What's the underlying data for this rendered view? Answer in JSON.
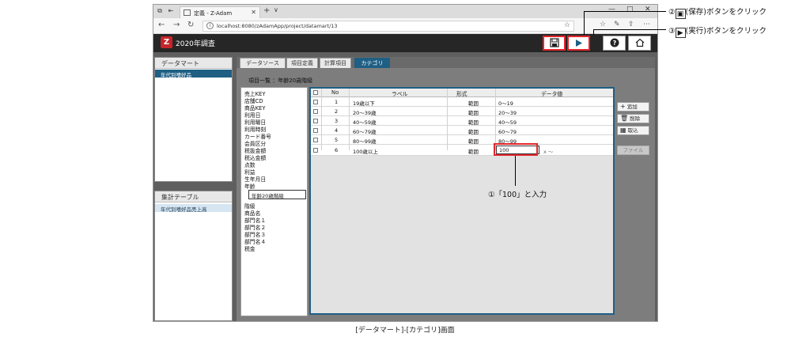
{
  "browser": {
    "tab_title": "定義 - Z-Adam",
    "url": "localhost:8080/zAdamApp/project/datamart/13"
  },
  "app": {
    "logo": "Z",
    "title": "2020年調査"
  },
  "left_panels": {
    "datamart_title": "データマート",
    "datamart_selected": "年代別嗜好品",
    "aggregate_title": "集計テーブル",
    "aggregate_selected": "年代別嗜好品売上高"
  },
  "tabs": [
    "データソース",
    "項目定義",
    "計算項目",
    "カテゴリ"
  ],
  "item_list_label": "項目一覧 ：年齢20歳階級",
  "fields_before": [
    "売上KEY",
    "店舗CD",
    "商品KEY",
    "利用日",
    "利用曜日",
    "利用時刻",
    "カード番号",
    "会員区分",
    "税抜金額",
    "税込金額",
    "点数",
    "利益",
    "生年月日",
    "年齢"
  ],
  "field_selected": "年齢20歳階級",
  "fields_after": [
    "階級",
    "商品名",
    "部門名１",
    "部門名２",
    "部門名３",
    "部門名４",
    "税金"
  ],
  "grid": {
    "headers": [
      "No",
      "ラベル",
      "形式",
      "データ値"
    ],
    "rows": [
      {
        "no": "1",
        "label": "19歳以下",
        "format": "範囲",
        "value": "0～19"
      },
      {
        "no": "2",
        "label": "20～39歳",
        "format": "範囲",
        "value": "20～39"
      },
      {
        "no": "3",
        "label": "40～59歳",
        "format": "範囲",
        "value": "40～59"
      },
      {
        "no": "4",
        "label": "60～79歳",
        "format": "範囲",
        "value": "60～79"
      },
      {
        "no": "5",
        "label": "80～99歳",
        "format": "範囲",
        "value": "80～99"
      },
      {
        "no": "6",
        "label": "100歳以上",
        "format": "範囲",
        "value": "100",
        "suffix": "x ～"
      }
    ]
  },
  "side_buttons": {
    "add": "追加",
    "delete": "削除",
    "import": "取込",
    "file": "ファイル"
  },
  "annotations": {
    "save_num": "②",
    "save_text": "(保存)ボタンをクリック",
    "run_num": "③",
    "run_text": "(実行)ボタンをクリック",
    "input_text": "①「100」と入力"
  },
  "caption": "[データマート]-[カテゴリ]画面"
}
